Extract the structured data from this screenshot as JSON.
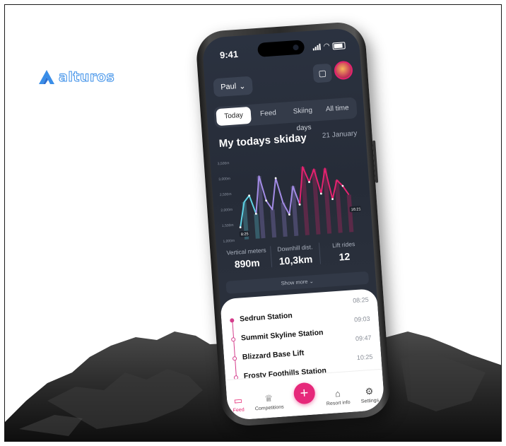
{
  "brand": {
    "name": "alturos"
  },
  "status_bar": {
    "time": "9:41"
  },
  "header": {
    "user": "Paul"
  },
  "tabs": [
    {
      "label": "Today",
      "active": true
    },
    {
      "label": "Feed",
      "active": false
    },
    {
      "label": "Skiing days",
      "active": false
    },
    {
      "label": "All time",
      "active": false
    }
  ],
  "card": {
    "title": "My todays skiday",
    "date": "21 January"
  },
  "chart_data": {
    "type": "line",
    "y_tick_labels": [
      "3,500m",
      "3,000m",
      "2,500m",
      "2,000m",
      "1,500m",
      "1,000m"
    ],
    "ylim": [
      1000,
      3500
    ],
    "start_label": "8:25",
    "end_label": "16:21",
    "series": [
      {
        "color": "#5fd3e6",
        "values": [
          1400,
          2200,
          2400,
          1800
        ]
      },
      {
        "color": "#a38ce6",
        "values": [
          1800,
          3000,
          2200,
          1900,
          2900,
          2100,
          1700,
          2600,
          2000
        ]
      },
      {
        "color": "#e4226f",
        "values": [
          2000,
          3200,
          2700,
          3100,
          2300,
          3100,
          2100,
          2700,
          2500,
          2200
        ]
      }
    ]
  },
  "stats": [
    {
      "label": "Vertical meters",
      "value": "890m"
    },
    {
      "label": "Downhill dist.",
      "value": "10,3km"
    },
    {
      "label": "Lift rides",
      "value": "12"
    }
  ],
  "show_more": "Show more",
  "stations": [
    {
      "name": "Sedrun Station",
      "time": "08:25"
    },
    {
      "name": "Summit Skyline Station",
      "time": "09:03"
    },
    {
      "name": "Blizzard Base Lift",
      "time": "09:47"
    },
    {
      "name": "Frosty Foothills Station",
      "time": "10:25"
    }
  ],
  "nav": [
    {
      "label": "Feed",
      "icon": "feed-icon",
      "active": true
    },
    {
      "label": "Competitions",
      "icon": "trophy-icon",
      "active": false
    },
    {
      "label": "",
      "icon": "plus-icon",
      "active": false
    },
    {
      "label": "Resort info",
      "icon": "resort-icon",
      "active": false
    },
    {
      "label": "Settings",
      "icon": "gear-icon",
      "active": false
    }
  ],
  "colors": {
    "accent": "#e4226f",
    "brand": "#3a8ee8",
    "screen_bg": "#2b3240"
  }
}
